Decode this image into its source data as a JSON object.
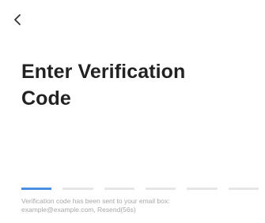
{
  "header": {
    "back_icon": "chevron-left-icon"
  },
  "title": {
    "line1": "Enter Verification",
    "line2": "Code"
  },
  "code_input": {
    "length": 6,
    "active_index": 0,
    "active_color": "#4a90e2",
    "inactive_color": "#e6e6e6"
  },
  "info": {
    "sent_text": "Verification code has been sent to your email box:",
    "email": "example@example.com",
    "resend_label": "Resend(56s)"
  }
}
